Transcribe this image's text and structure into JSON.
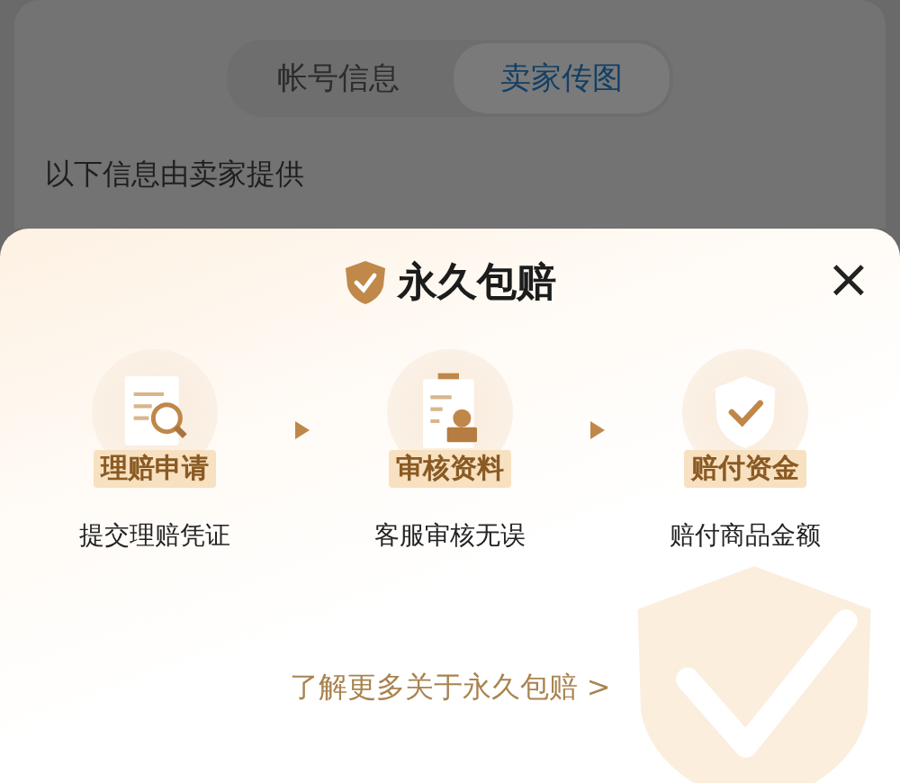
{
  "tabs": [
    {
      "label": "帐号信息",
      "selected": false
    },
    {
      "label": "卖家传图",
      "selected": true
    }
  ],
  "note": "以下信息由卖家提供",
  "sheet": {
    "title": "永久包赔",
    "close": "×",
    "steps": [
      {
        "kind": "apply",
        "badge": "理赔申请",
        "caption": "提交理赔凭证"
      },
      {
        "kind": "review",
        "badge": "审核资料",
        "caption": "客服审核无误"
      },
      {
        "kind": "pay",
        "badge": "赔付资金",
        "caption": "赔付商品金额"
      }
    ],
    "link": "了解更多关于永久包赔 >"
  }
}
